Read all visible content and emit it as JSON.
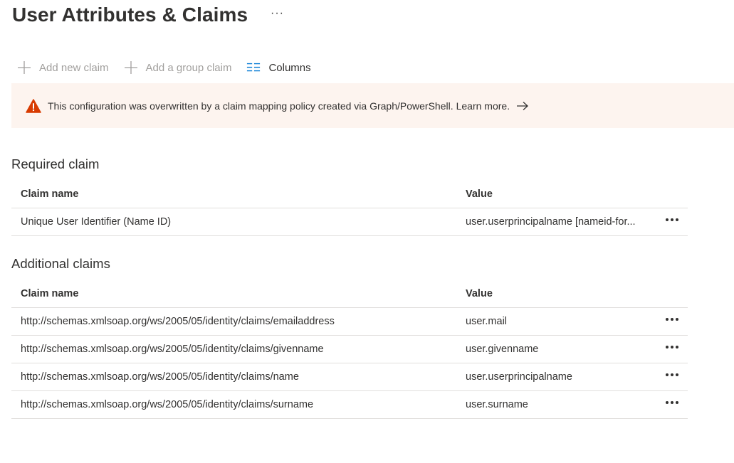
{
  "page": {
    "title": "User Attributes & Claims",
    "more_label": "···"
  },
  "toolbar": {
    "add_claim": "Add new claim",
    "add_group_claim": "Add a group claim",
    "columns": "Columns"
  },
  "banner": {
    "message": "This configuration was overwritten by a claim mapping policy created via Graph/PowerShell.",
    "link": "Learn more.",
    "icon": "warning-icon",
    "accent": "#d83b01"
  },
  "required": {
    "title": "Required claim",
    "headers": {
      "name": "Claim name",
      "value": "Value"
    },
    "rows": [
      {
        "name": "Unique User Identifier (Name ID)",
        "value": "user.userprincipalname [nameid-for..."
      }
    ]
  },
  "additional": {
    "title": "Additional claims",
    "headers": {
      "name": "Claim name",
      "value": "Value"
    },
    "rows": [
      {
        "name": "http://schemas.xmlsoap.org/ws/2005/05/identity/claims/emailaddress",
        "value": "user.mail"
      },
      {
        "name": "http://schemas.xmlsoap.org/ws/2005/05/identity/claims/givenname",
        "value": "user.givenname"
      },
      {
        "name": "http://schemas.xmlsoap.org/ws/2005/05/identity/claims/name",
        "value": "user.userprincipalname"
      },
      {
        "name": "http://schemas.xmlsoap.org/ws/2005/05/identity/claims/surname",
        "value": "user.surname"
      }
    ]
  },
  "colors": {
    "text": "#323130",
    "disabled": "#a19f9d",
    "accent_blue": "#0078d4",
    "banner_bg": "#fdf4ef",
    "divider": "#e1dfdd"
  }
}
